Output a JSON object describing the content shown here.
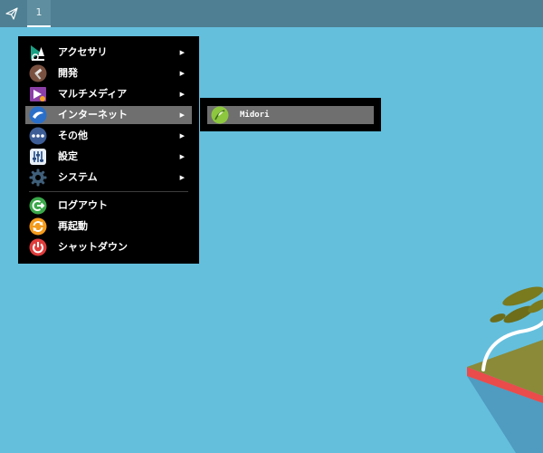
{
  "panel": {
    "launcher_icon": "paper-plane-icon",
    "workspace_label": "1"
  },
  "main_menu": {
    "items": [
      {
        "label": "アクセサリ",
        "icon": "accessories-icon",
        "has_submenu": true
      },
      {
        "label": "開発",
        "icon": "development-icon",
        "has_submenu": true
      },
      {
        "label": "マルチメディア",
        "icon": "multimedia-icon",
        "has_submenu": true
      },
      {
        "label": "インターネット",
        "icon": "internet-icon",
        "has_submenu": true,
        "highlighted": true
      },
      {
        "label": "その他",
        "icon": "other-icon",
        "has_submenu": true
      },
      {
        "label": "設定",
        "icon": "settings-icon",
        "has_submenu": true
      },
      {
        "label": "システム",
        "icon": "system-icon",
        "has_submenu": true
      },
      {
        "label": "ログアウト",
        "icon": "logout-icon",
        "has_submenu": false
      },
      {
        "label": "再起動",
        "icon": "restart-icon",
        "has_submenu": false
      },
      {
        "label": "シャットダウン",
        "icon": "shutdown-icon",
        "has_submenu": false
      }
    ],
    "submenu_arrow": "▶"
  },
  "sub_menu": {
    "items": [
      {
        "label": "Midori",
        "icon": "midori-icon",
        "highlighted": true
      }
    ]
  },
  "colors": {
    "desktop_background": "#64bfdd",
    "panel": "#4e7f92",
    "menu_background": "#000000",
    "menu_highlight": "#6f6f6f"
  }
}
